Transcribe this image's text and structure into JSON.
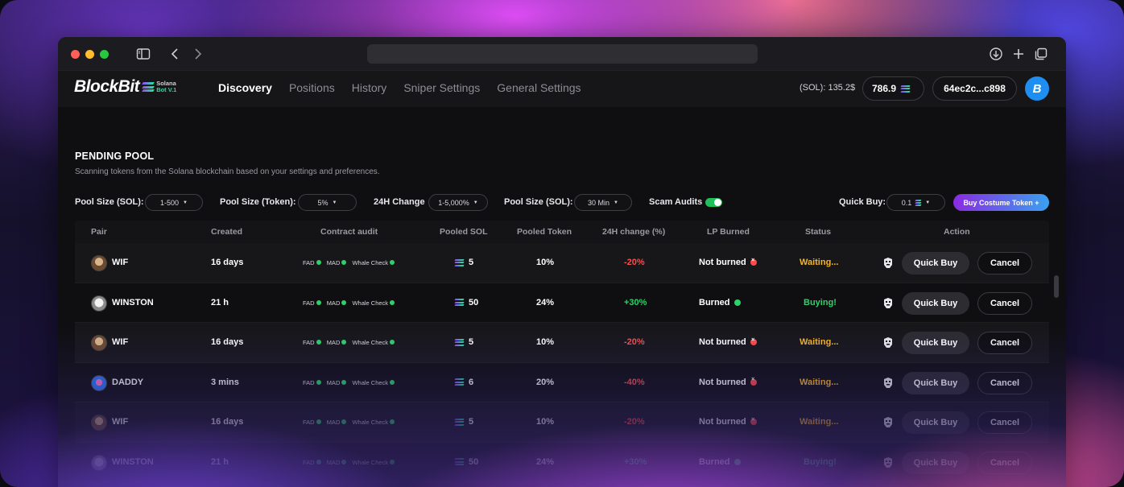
{
  "nav": {
    "logo_text": "BlockBit",
    "logo_sub_line1": "Solana",
    "logo_sub_line2": "Bot V.1",
    "tabs": [
      {
        "label": "Discovery",
        "active": true
      },
      {
        "label": "Positions",
        "active": false
      },
      {
        "label": "History",
        "active": false
      },
      {
        "label": "Sniper Settings",
        "active": false
      },
      {
        "label": "General Settings",
        "active": false
      }
    ],
    "sol_price": "(SOL): 135.2$",
    "balance": "786.9",
    "wallet": "64ec2c...c898",
    "avatar_letter": "B"
  },
  "page": {
    "title": "PENDING POOL",
    "subtitle": "Scanning tokens from the Solana blockchain based on your settings and preferences."
  },
  "filters": {
    "pool_size_sol_label": "Pool Size (SOL):",
    "pool_size_sol_value": "1-500",
    "pool_size_token_label": "Pool Size (Token):",
    "pool_size_token_value": "5%",
    "change_24h_label": "24H Change",
    "change_24h_value": "1-5,000%",
    "pool_size_sol2_label": "Pool Size (SOL):",
    "pool_size_sol2_value": "30 Min",
    "scam_audits_label": "Scam Audits",
    "scam_audits_on": true,
    "quick_buy_label": "Quick Buy:",
    "quick_buy_value": "0.1",
    "buy_custom_label": "Buy Costume Token +"
  },
  "table": {
    "headers": [
      "Pair",
      "Created",
      "Contract audit",
      "Pooled SOL",
      "Pooled Token",
      "24H change (%)",
      "LP Burned",
      "Status",
      "Action"
    ],
    "audit_labels": [
      "FAD",
      "MAD",
      "Whale Check"
    ],
    "quick_buy_label": "Quick Buy",
    "cancel_label": "Cancel",
    "rows": [
      {
        "pair": "WIF",
        "avatar": "wif",
        "created": "16 days",
        "pooled_sol": "5",
        "pooled_token": "10%",
        "change": "-20%",
        "trend": "neg",
        "lp": "Not burned",
        "lp_ok": false,
        "status": "Waiting...",
        "status_kind": "waiting"
      },
      {
        "pair": "WINSTON",
        "avatar": "winston",
        "created": "21 h",
        "pooled_sol": "50",
        "pooled_token": "24%",
        "change": "+30%",
        "trend": "pos",
        "lp": "Burned",
        "lp_ok": true,
        "status": "Buying!",
        "status_kind": "buying"
      },
      {
        "pair": "WIF",
        "avatar": "wif",
        "created": "16 days",
        "pooled_sol": "5",
        "pooled_token": "10%",
        "change": "-20%",
        "trend": "neg",
        "lp": "Not burned",
        "lp_ok": false,
        "status": "Waiting...",
        "status_kind": "waiting"
      },
      {
        "pair": "DADDY",
        "avatar": "daddy",
        "created": "3 mins",
        "pooled_sol": "6",
        "pooled_token": "20%",
        "change": "-40%",
        "trend": "neg",
        "lp": "Not burned",
        "lp_ok": false,
        "status": "Waiting...",
        "status_kind": "waiting"
      },
      {
        "pair": "WIF",
        "avatar": "wif",
        "created": "16 days",
        "pooled_sol": "5",
        "pooled_token": "10%",
        "change": "-20%",
        "trend": "neg",
        "lp": "Not burned",
        "lp_ok": false,
        "status": "Waiting...",
        "status_kind": "waiting"
      },
      {
        "pair": "WINSTON",
        "avatar": "winston",
        "created": "21 h",
        "pooled_sol": "50",
        "pooled_token": "24%",
        "change": "+30%",
        "trend": "pos",
        "lp": "Burned",
        "lp_ok": true,
        "status": "Buying!",
        "status_kind": "buying"
      }
    ]
  },
  "colors": {
    "accent_green": "#2fd06a",
    "accent_red": "#ff4b4b",
    "waiting": "#f5b52a",
    "brand_blue": "#1e8ff0"
  }
}
